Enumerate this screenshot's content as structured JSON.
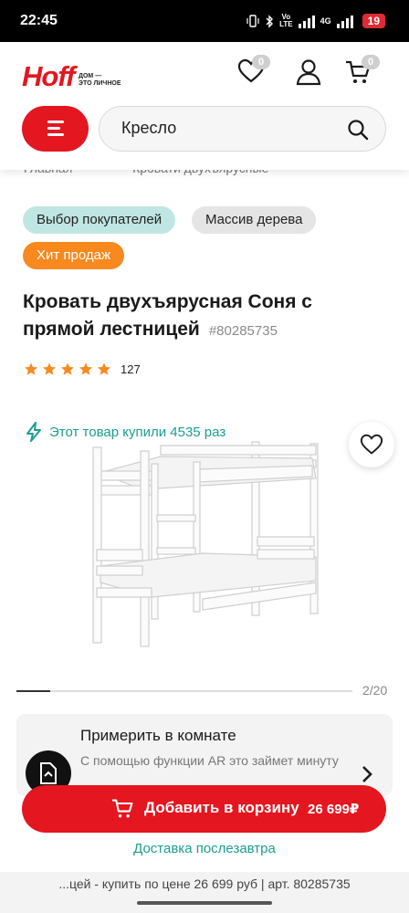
{
  "status_bar": {
    "time": "22:45",
    "network_top": "Vo",
    "network_bottom": "LTE",
    "network_label": "4G",
    "battery": "19"
  },
  "header": {
    "logo": "Hoff",
    "tagline_line1": "ДОМ —",
    "tagline_line2": "ЭТО ЛИЧНОЕ",
    "favorites_count": "0",
    "cart_count": "0",
    "search_value": "Кресло",
    "brand_color": "#e4161f"
  },
  "breadcrumb": {
    "items": [
      "Главная",
      "Кровати двухъярусные"
    ],
    "separator": "—"
  },
  "badges": {
    "buyers_choice": "Выбор покупателей",
    "solid_wood": "Массив дерева",
    "hit": "Хит продаж"
  },
  "product": {
    "title": "Кровать двухъярусная Соня с прямой лестницей",
    "sku": "#80285735",
    "rating_stars": 5,
    "reviews_count": "127",
    "bought_text": "Этот товар купили 4535 раз",
    "gallery_position": "2/20",
    "gallery_progress": 0.1
  },
  "ar_block": {
    "title": "Примерить в комнате",
    "description": "С помощью функции AR это займет минуту"
  },
  "cta": {
    "label": "Добавить в корзину",
    "price": "26 699₽",
    "delivery": "Доставка послезавтра"
  },
  "browser": {
    "url_text": "...цей - купить по цене 26 699 руб | арт. 80285735"
  }
}
